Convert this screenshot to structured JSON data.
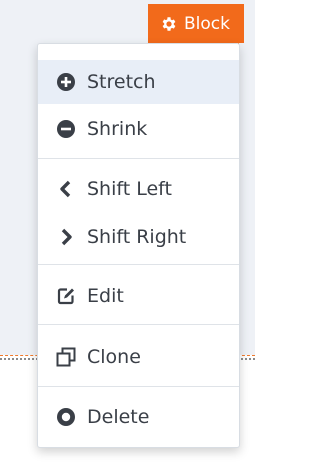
{
  "block_button": {
    "label": "Block",
    "icon": "gear-icon",
    "color": "#f26a1b"
  },
  "menu": {
    "items": [
      {
        "label": "Stretch",
        "icon": "plus-circle-icon"
      },
      {
        "label": "Shrink",
        "icon": "minus-circle-icon"
      },
      {
        "label": "Shift Left",
        "icon": "chevron-left-icon"
      },
      {
        "label": "Shift Right",
        "icon": "chevron-right-icon"
      },
      {
        "label": "Edit",
        "icon": "edit-icon"
      },
      {
        "label": "Clone",
        "icon": "clone-icon"
      },
      {
        "label": "Delete",
        "icon": "delete-circle-icon"
      }
    ]
  },
  "colors": {
    "accent": "#f26a1b",
    "menu_text": "#3a3f47",
    "highlight": "#e8eef7"
  }
}
